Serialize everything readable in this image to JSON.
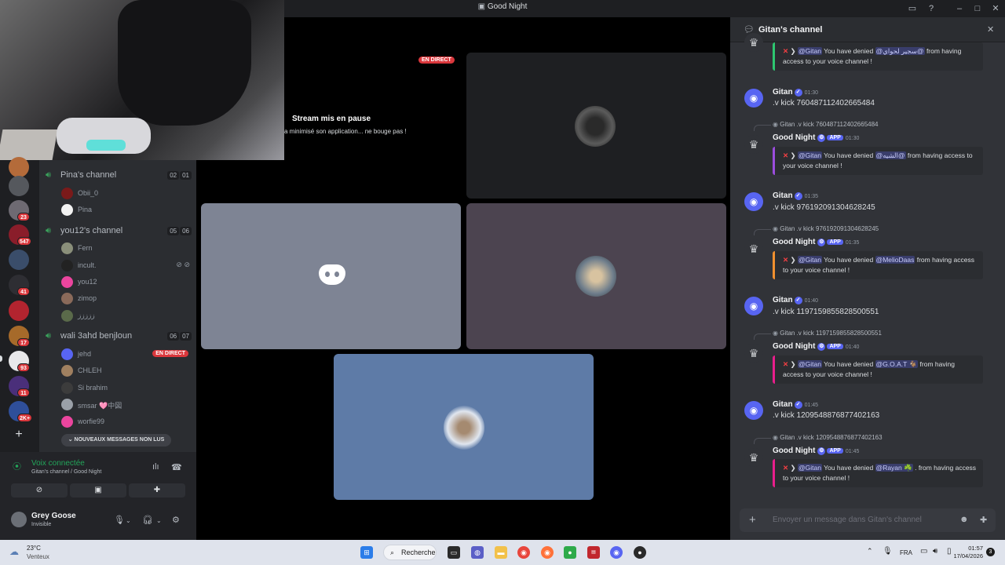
{
  "window": {
    "title": "Good Night"
  },
  "stage": {
    "live_badge": "EN DIRECT",
    "paused_title": "Stream mis en pause",
    "paused_sub": "a minimisé son application... ne bouge pas !"
  },
  "servers": {
    "badges": [
      "23",
      "547",
      "41",
      "17",
      "93",
      "11",
      "2K+"
    ]
  },
  "channels": [
    {
      "name": "Pina's channel",
      "count_a": "02",
      "count_b": "01",
      "users": [
        "Obii_0",
        "Pina"
      ]
    },
    {
      "name": "you12's channel",
      "count_a": "05",
      "count_b": "06",
      "users": [
        "Fern",
        "incult.",
        "you12",
        "zimop",
        "ززززز"
      ]
    },
    {
      "name": "wali 3ahd benjloun",
      "count_a": "06",
      "count_b": "07",
      "users": [
        "jehd",
        "CHLEH",
        "Si brahim",
        "smsar 🩷中図",
        "worfie99"
      ]
    }
  ],
  "sidebar": {
    "live_badge": "EN DIRECT",
    "unread": "NOUVEAUX MESSAGES NON LUS"
  },
  "voice": {
    "status": "Voix connectée",
    "location": "Gitan's channel / Good Night"
  },
  "user": {
    "name": "Grey Goose",
    "status": "Invisible"
  },
  "chat": {
    "title": "Gitan's channel",
    "input_placeholder": "Envoyer un message dans Gitan's channel",
    "top_embed": {
      "mention": "@Gitan",
      "text_a": "You have denied",
      "target": "@سجير لحواي@",
      "text_b": "from having access to your voice channel !"
    },
    "messages": [
      {
        "author": "Gitan",
        "time": "01:30",
        "text": ".v kick 760487112402665484",
        "reply": "Gitan .v kick 760487112402665484",
        "bot": "Good Night",
        "app": "APP",
        "bot_time": "01:30",
        "mention": "@Gitan",
        "denied": "You have denied",
        "target": "@الشيه@",
        "tail": "from having access to your voice channel !"
      },
      {
        "author": "Gitan",
        "time": "01:35",
        "text": ".v kick 976192091304628245",
        "reply": "Gitan .v kick 976192091304628245",
        "bot": "Good Night",
        "app": "APP",
        "bot_time": "01:35",
        "mention": "@Gitan",
        "denied": "You have denied",
        "target": "@MelioDaas",
        "tail": "from having access to your voice channel !"
      },
      {
        "author": "Gitan",
        "time": "01:40",
        "text": ".v kick 1197159855828500551",
        "reply": "Gitan .v kick 1197159855828500551",
        "bot": "Good Night",
        "app": "APP",
        "bot_time": "01:40",
        "mention": "@Gitan",
        "denied": "You have denied",
        "target": "@G.O.A.T 🐐",
        "tail": "from having access to your voice channel !"
      },
      {
        "author": "Gitan",
        "time": "01:45",
        "text": ".v kick 1209548876877402163",
        "reply": "Gitan .v kick 1209548876877402163",
        "bot": "Good Night",
        "app": "APP",
        "bot_time": "01:45",
        "mention": "@Gitan",
        "denied": "You have denied",
        "target": "@Rayan ☘️",
        "tail": ". from having access to your voice channel !"
      }
    ]
  },
  "taskbar": {
    "weather_temp": "23°C",
    "weather_desc": "Venteux",
    "search": "Recherche",
    "lang": "FRA",
    "time": "01:57",
    "date": "17/04/2026",
    "notif_count": "3"
  },
  "colors": {
    "embed_bars": [
      "#2dc770",
      "#9b4dde",
      "#f0902f",
      "#e91e8c",
      "#e91e8c"
    ]
  }
}
